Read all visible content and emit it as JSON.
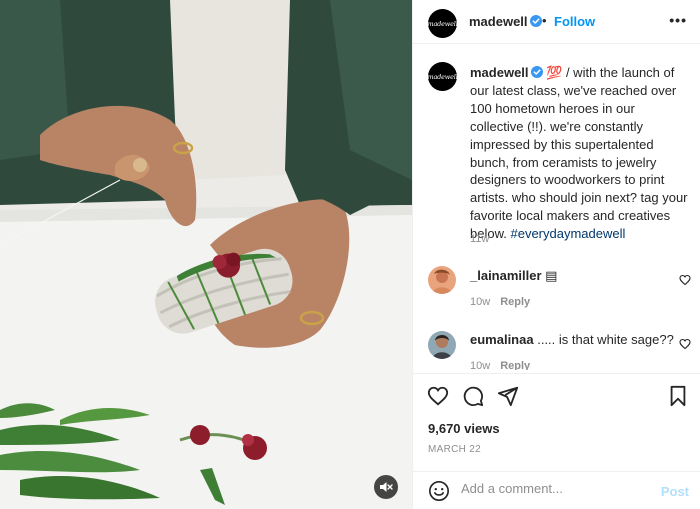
{
  "header": {
    "avatar_text": "madewell",
    "username": "madewell",
    "dot": "•",
    "follow_label": "Follow",
    "more_label": "•••"
  },
  "caption": {
    "avatar_text": "madewell",
    "username": "madewell",
    "emoji": "💯",
    "text": " / with the launch of our latest class, we've reached over 100 hometown heroes in our collective (!!). we're constantly impressed by this supertalented bunch, from ceramists to jewelry designers to woodworkers to print artists. who should join next? tag your favorite local makers and creatives below. ",
    "hashtag": "#everydaymadewell",
    "time": "11w"
  },
  "comments": [
    {
      "username": "_lainamiller",
      "text": "▤",
      "time": "10w",
      "reply_label": "Reply"
    },
    {
      "username": "eumalinaa",
      "text": "..... is that white sage??",
      "time": "10w",
      "reply_label": "Reply"
    }
  ],
  "stats": {
    "views": "9,670 views",
    "date": "MARCH 22"
  },
  "add_comment": {
    "placeholder": "Add a comment...",
    "post_label": "Post"
  },
  "colors": {
    "link_blue": "#0095f6",
    "hashtag": "#00376b",
    "muted": "#8e8e8e",
    "post_disabled": "#b2dffc"
  },
  "icons": {
    "verified": "verified-badge-icon",
    "like": "heart-icon",
    "comment": "comment-icon",
    "share": "paper-plane-icon",
    "save": "bookmark-icon",
    "emoji": "smiley-icon",
    "mute": "speaker-muted-icon"
  }
}
